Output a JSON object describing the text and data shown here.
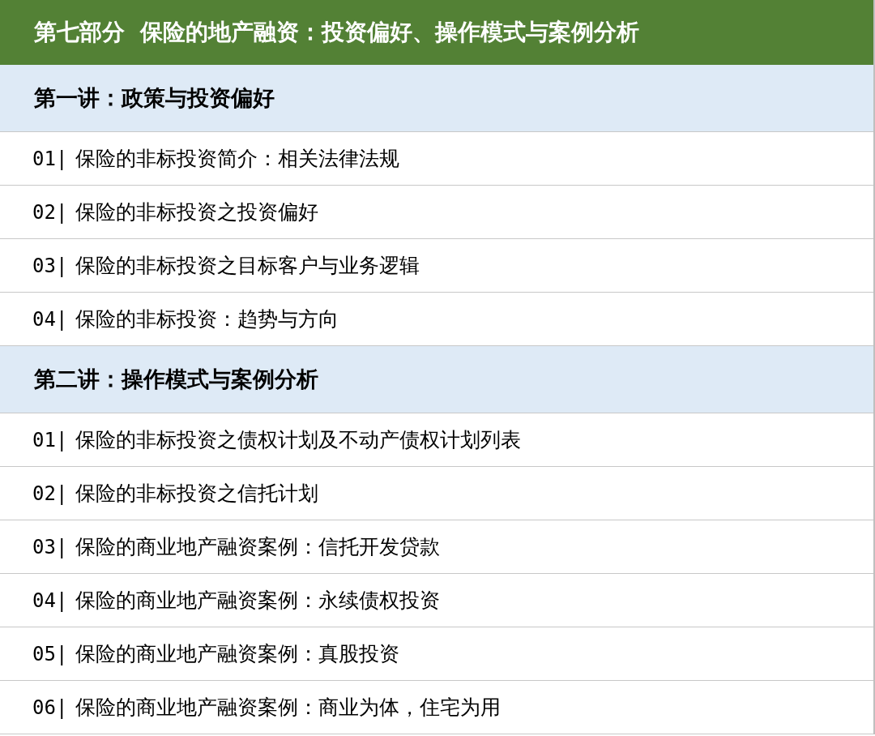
{
  "header": {
    "title": "第七部分  保险的地产融资：投资偏好、操作模式与案例分析"
  },
  "sections": [
    {
      "title": "第一讲：政策与投资偏好",
      "items": [
        {
          "number": "01|",
          "title": "保险的非标投资简介：相关法律法规"
        },
        {
          "number": "02|",
          "title": "保险的非标投资之投资偏好"
        },
        {
          "number": "03|",
          "title": "保险的非标投资之目标客户与业务逻辑"
        },
        {
          "number": "04|",
          "title": "保险的非标投资：趋势与方向"
        }
      ]
    },
    {
      "title": "第二讲：操作模式与案例分析",
      "items": [
        {
          "number": "01|",
          "title": "保险的非标投资之债权计划及不动产债权计划列表"
        },
        {
          "number": "02|",
          "title": "保险的非标投资之信托计划"
        },
        {
          "number": "03|",
          "title": "保险的商业地产融资案例：信托开发贷款"
        },
        {
          "number": "04|",
          "title": "保险的商业地产融资案例：永续债权投资"
        },
        {
          "number": "05|",
          "title": "保险的商业地产融资案例：真股投资"
        },
        {
          "number": "06|",
          "title": "保险的商业地产融资案例：商业为体，住宅为用"
        }
      ]
    }
  ]
}
